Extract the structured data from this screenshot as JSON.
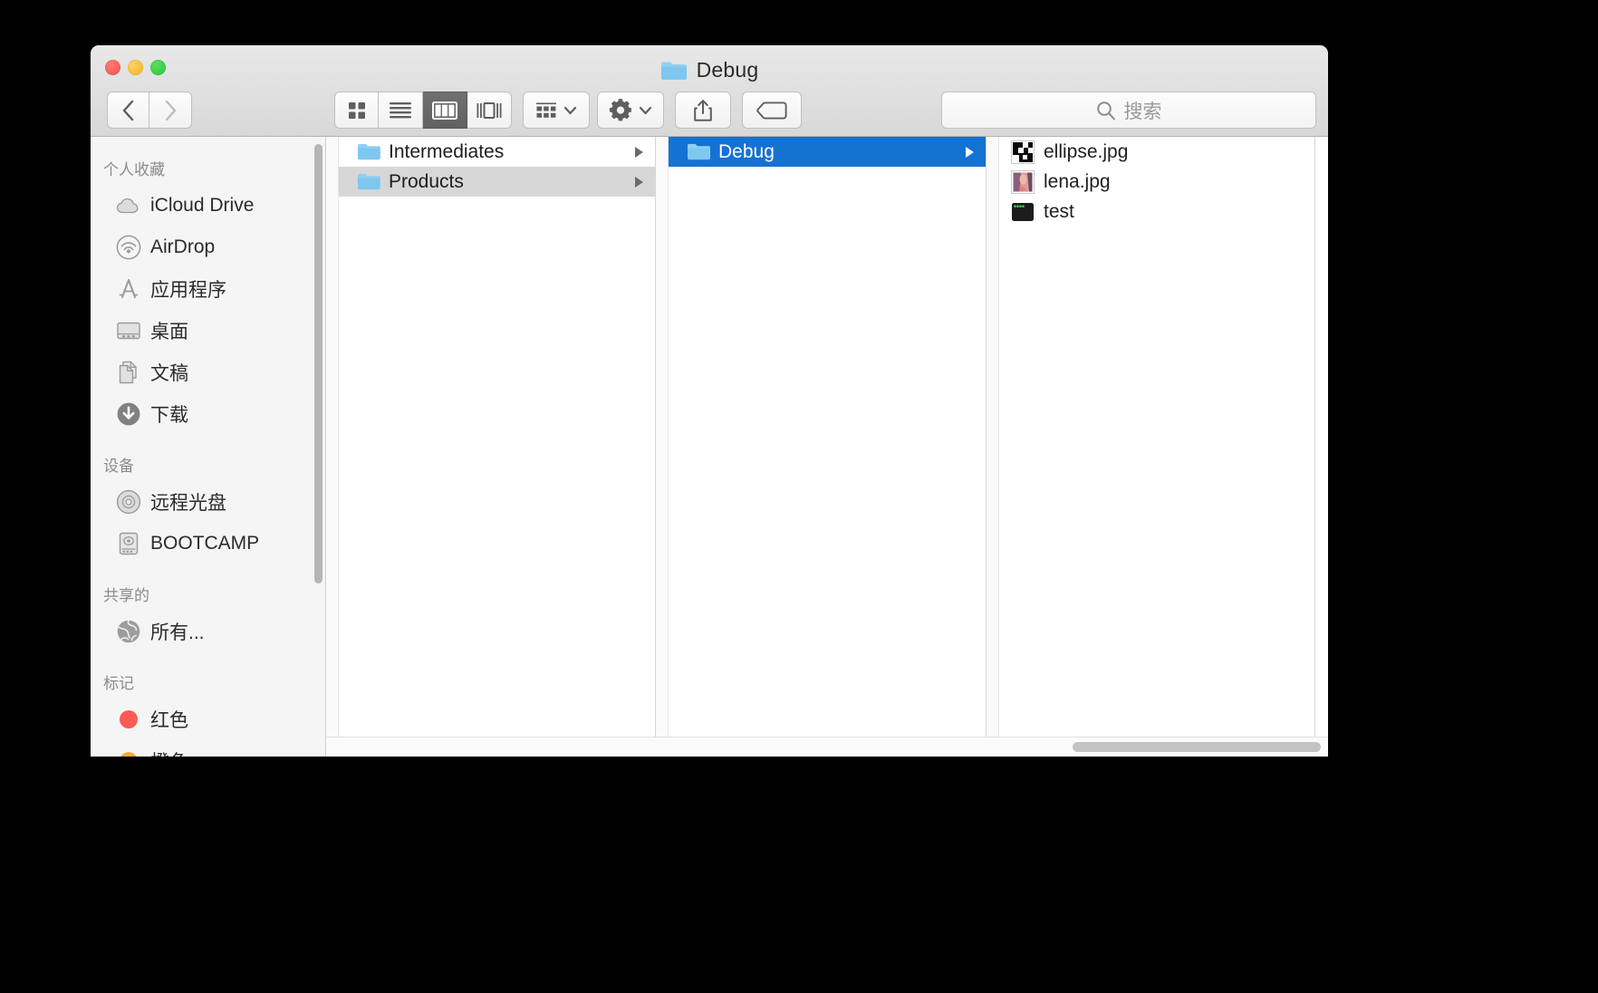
{
  "window": {
    "title": "Debug",
    "title_icon": "folder-icon",
    "traffic_lights": [
      {
        "name": "close-button",
        "color": "#ef5349"
      },
      {
        "name": "minimize-button",
        "color": "#f2b31c"
      },
      {
        "name": "maximize-button",
        "color": "#27c53c"
      }
    ]
  },
  "toolbar": {
    "back_label": "‹",
    "forward_label": "›",
    "view_modes": [
      {
        "name": "icon-view",
        "icon": "grid-icon",
        "active": false
      },
      {
        "name": "list-view",
        "icon": "list-icon",
        "active": false
      },
      {
        "name": "column-view",
        "icon": "columns-icon",
        "active": true
      },
      {
        "name": "gallery-view",
        "icon": "coverflow-icon",
        "active": false
      }
    ],
    "arrange_button": {
      "icon": "arrange-grid-icon",
      "chevron": "chevron-down-icon"
    },
    "action_button": {
      "icon": "gear-icon",
      "chevron": "chevron-down-icon"
    },
    "share_button": {
      "icon": "share-icon"
    },
    "tags_button": {
      "icon": "tag-icon"
    }
  },
  "search": {
    "placeholder": "搜索",
    "value": "",
    "icon": "search-icon"
  },
  "sidebar": {
    "sections": [
      {
        "header": "个人收藏",
        "items": [
          {
            "label": "iCloud Drive",
            "icon": "icloud-icon"
          },
          {
            "label": "AirDrop",
            "icon": "airdrop-icon"
          },
          {
            "label": "应用程序",
            "icon": "applications-icon"
          },
          {
            "label": "桌面",
            "icon": "desktop-icon"
          },
          {
            "label": "文稿",
            "icon": "documents-icon"
          },
          {
            "label": "下载",
            "icon": "downloads-icon"
          }
        ]
      },
      {
        "header": "设备",
        "items": [
          {
            "label": "远程光盘",
            "icon": "remote-disc-icon"
          },
          {
            "label": "BOOTCAMP",
            "icon": "hard-drive-icon"
          }
        ]
      },
      {
        "header": "共享的",
        "items": [
          {
            "label": "所有...",
            "icon": "network-globe-icon"
          }
        ]
      },
      {
        "header": "标记",
        "items": [
          {
            "label": "红色",
            "icon": "tag-dot-icon",
            "color": "#fb5b55"
          },
          {
            "label": "橙色",
            "icon": "tag-dot-icon",
            "color": "#f6a93c"
          }
        ]
      }
    ]
  },
  "columns": [
    {
      "name": "column-1",
      "rows": [
        {
          "label": "Intermediates",
          "icon": "folder-icon",
          "selected": "none",
          "has_children": true
        },
        {
          "label": "Products",
          "icon": "folder-icon",
          "selected": "inactive",
          "has_children": true
        }
      ]
    },
    {
      "name": "column-2",
      "rows": [
        {
          "label": "Debug",
          "icon": "folder-icon",
          "selected": "active",
          "has_children": true
        }
      ]
    },
    {
      "name": "column-3",
      "rows": [
        {
          "label": "ellipse.jpg",
          "icon": "image-thumbnail-ellipse",
          "selected": "none",
          "has_children": false
        },
        {
          "label": "lena.jpg",
          "icon": "image-thumbnail-lena",
          "selected": "none",
          "has_children": false
        },
        {
          "label": "test",
          "icon": "executable-icon",
          "selected": "none",
          "has_children": false
        }
      ]
    }
  ],
  "colors": {
    "selection_blue": "#1472d3",
    "selection_gray": "#d7d7d7",
    "folder_blue": "#81ccf0",
    "sidebar_bg": "#f5f5f5",
    "titlebar_top": "#e8e8e8",
    "titlebar_bottom": "#d8d8d8"
  }
}
